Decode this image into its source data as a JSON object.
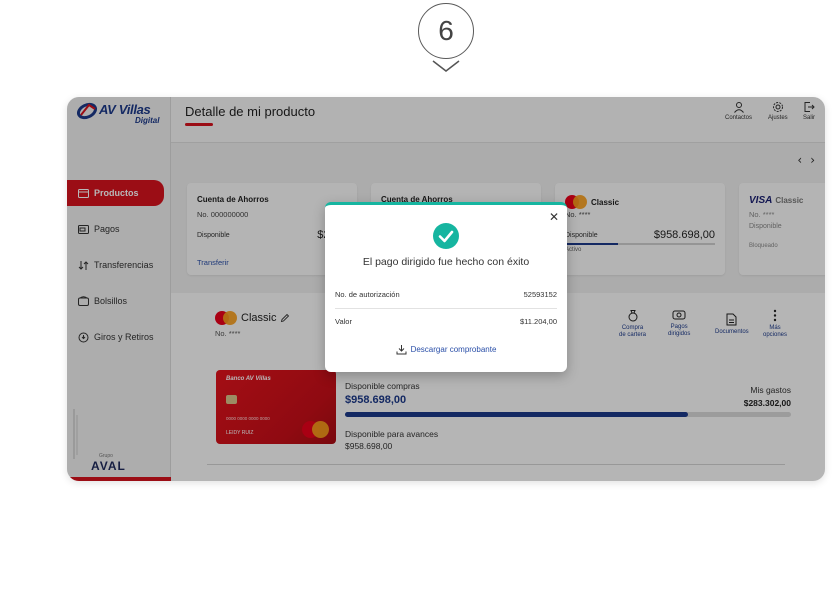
{
  "step": {
    "number": "6"
  },
  "sidebar": {
    "logo_text": "AV Villas",
    "logo_sub": "Digital",
    "items": [
      {
        "label": "Productos",
        "icon": "card-icon",
        "active": true
      },
      {
        "label": "Pagos",
        "icon": "payment-icon",
        "active": false
      },
      {
        "label": "Transferencias",
        "icon": "transfer-icon",
        "active": false
      },
      {
        "label": "Bolsillos",
        "icon": "wallet-icon",
        "active": false
      },
      {
        "label": "Giros y Retiros",
        "icon": "withdraw-icon",
        "active": false
      }
    ],
    "grupo": "Grupo",
    "aval": "AVAL"
  },
  "header": {
    "title": "Detalle de mi producto",
    "buttons": [
      {
        "label": "Contactos",
        "icon": "person-icon"
      },
      {
        "label": "Ajustes",
        "icon": "gear-icon"
      },
      {
        "label": "Salir",
        "icon": "logout-icon"
      }
    ]
  },
  "products": [
    {
      "title": "Cuenta de Ahorros",
      "number": "No. 000000000",
      "label": "Disponible",
      "value": "$213.30",
      "link": "Transferir"
    },
    {
      "title": "Cuenta de Ahorros"
    },
    {
      "title": "Classic",
      "number": "No. ****",
      "label": "Disponible",
      "value": "$958.698,00",
      "status": "Activo"
    },
    {
      "title": "Classic",
      "brand": "VISA",
      "number": "No. ****",
      "label": "Disponible",
      "status": "Bloqueado"
    }
  ],
  "detail": {
    "card_name": "Classic",
    "card_number": "No. ****",
    "actions": [
      {
        "label": "Compra\nde cartera",
        "icon": "purchase-icon"
      },
      {
        "label": "Pagos\ndirigidos",
        "icon": "directed-payments-icon"
      },
      {
        "label": "Documentos",
        "icon": "document-icon"
      },
      {
        "label": "Más\nopciones",
        "icon": "more-icon"
      }
    ],
    "credit_card": {
      "bank": "Banco AV Villas",
      "number": "0000 0000 0000 0000",
      "holder": "LEIDY RUIZ"
    },
    "available_label": "Disponible compras",
    "available_value": "$958.698,00",
    "spent_label": "Mis gastos",
    "spent_value": "$283.302,00",
    "usage_fraction": 0.77,
    "advances_label": "Disponible para avances",
    "advances_value": "$958.698,00"
  },
  "modal": {
    "message": "El pago dirigido fue hecho con éxito",
    "auth_label": "No. de autorización",
    "auth_value": "52593152",
    "value_label": "Valor",
    "value_value": "$11.204,00",
    "download_label": "Descargar comprobante",
    "accent_color": "#16b5a0"
  },
  "colors": {
    "brand_red": "#d7121e",
    "brand_blue": "#1d3a8a",
    "success_green": "#16b5a0"
  }
}
